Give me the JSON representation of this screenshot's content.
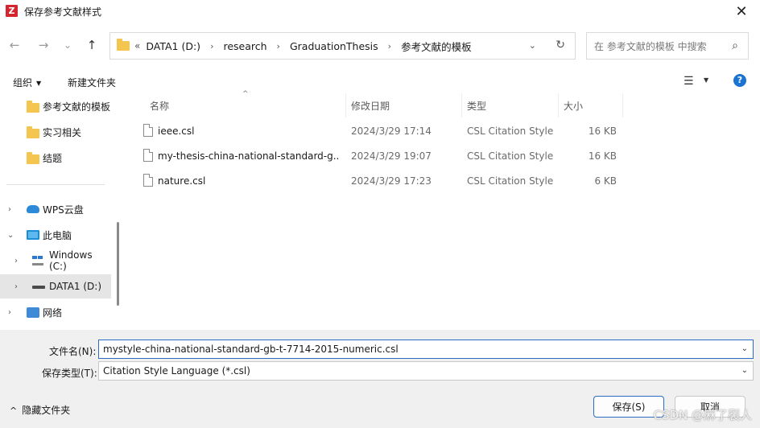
{
  "window": {
    "app_icon": "Z",
    "title": "保存参考文献样式",
    "close_glyph": "✕"
  },
  "nav": {
    "back_glyph": "←",
    "forward_glyph": "→",
    "recent_glyph": "⌄",
    "up_glyph": "↑",
    "address_chevron": "«",
    "breadcrumb": [
      "DATA1 (D:)",
      "research",
      "GraduationThesis",
      "参考文献的模板"
    ],
    "breadcrumb_separator": "›",
    "address_dropdown_glyph": "⌄",
    "refresh_glyph": "↻",
    "search_placeholder": "在 参考文献的模板 中搜索",
    "search_glyph": "⌕"
  },
  "toolbar": {
    "organize_label": "组织",
    "new_folder_label": "新建文件夹",
    "caret": "▼",
    "view_glyph": "☰",
    "view_dropdown_glyph": "▼",
    "help_glyph": "?"
  },
  "sidebar": {
    "expander_collapsed": "›",
    "expander_expanded": "⌄",
    "items": [
      {
        "label": "参考文献的模板",
        "icon": "folder-icon"
      },
      {
        "label": "实习相关",
        "icon": "folder-icon"
      },
      {
        "label": "结题",
        "icon": "folder-icon"
      },
      {
        "label": "WPS云盘",
        "icon": "cloud-icon"
      },
      {
        "label": "此电脑",
        "icon": "computer-icon"
      },
      {
        "label": "Windows (C:)",
        "icon": "windows-drive-icon"
      },
      {
        "label": "DATA1 (D:)",
        "icon": "drive-icon",
        "selected": true
      },
      {
        "label": "网络",
        "icon": "network-icon"
      }
    ]
  },
  "file_list": {
    "sort_glyph": "^",
    "columns": [
      "名称",
      "修改日期",
      "类型",
      "大小"
    ],
    "rows": [
      {
        "name": "ieee.csl",
        "modified": "2024/3/29 17:14",
        "type": "CSL Citation Style",
        "size": "16 KB"
      },
      {
        "name": "my-thesis-china-national-standard-g...",
        "modified": "2024/3/29 19:07",
        "type": "CSL Citation Style",
        "size": "16 KB"
      },
      {
        "name": "nature.csl",
        "modified": "2024/3/29 17:23",
        "type": "CSL Citation Style",
        "size": "6 KB"
      }
    ]
  },
  "save_form": {
    "filename_label": "文件名(N):",
    "filename_value": "mystyle-china-national-standard-gb-t-7714-2015-numeric.csl",
    "filetype_label": "保存类型(T):",
    "filetype_value": "Citation Style Language (*.csl)",
    "dropdown_glyph": "⌄"
  },
  "footer": {
    "hide_folders_glyph": "^",
    "hide_folders_label": "隐藏文件夹",
    "save_label": "保存(S)",
    "cancel_label": "取消",
    "watermark": "CSDN @麻了裂人"
  },
  "colors": {
    "accent": "#2b6cc4",
    "folder": "#f4c64f",
    "selection": "#e5e5e5",
    "app_icon": "#d3262f"
  }
}
